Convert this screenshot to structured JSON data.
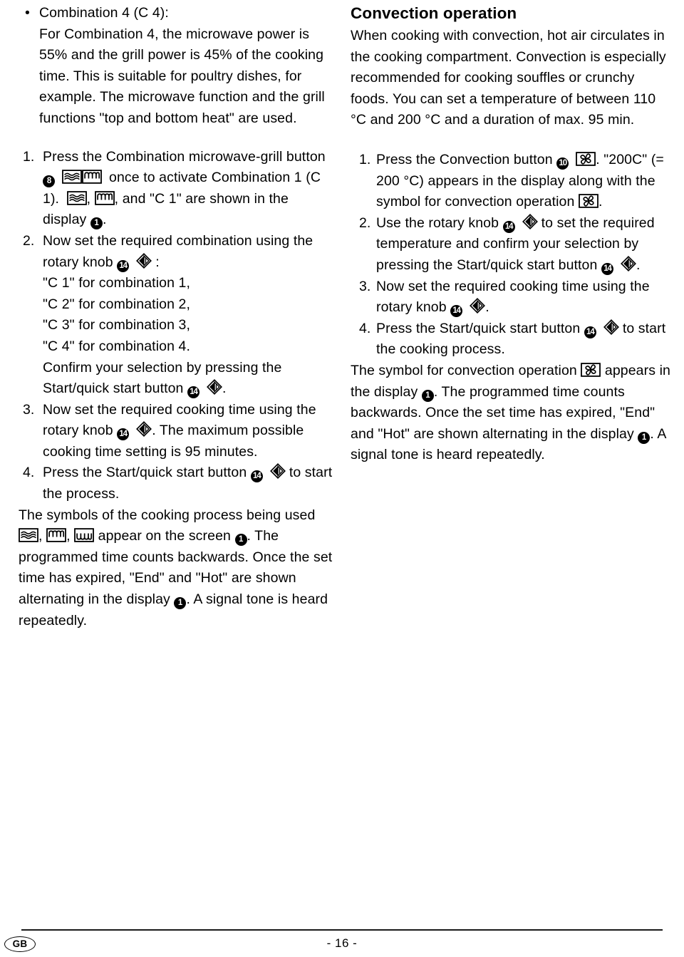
{
  "page": {
    "footer": {
      "language_badge": "GB",
      "page_number": "- 16 -"
    }
  },
  "left_column": {
    "bullet": {
      "marker": "•",
      "title": "Combination 4 (C 4):",
      "body": "For Combination 4, the microwave power is 55% and the grill power is 45% of the cooking time. This is suitable for poultry dishes, for example. The microwave function and the grill functions \"top and bottom heat\" are used."
    },
    "steps": {
      "s1_num": "1.",
      "s1_a": "Press the Combination microwave-grill button",
      "s1_badge": "8",
      "s1_b": "once to activate Combination 1 (C 1).",
      "s1_c": ",",
      "s1_d": ", and \"C 1\" are shown in the display",
      "s1_badge2": "1",
      "s1_e": ".",
      "s2_num": "2.",
      "s2_a": "Now set the required combination using the rotary knob",
      "s2_badge": "14",
      "s2_b": ":",
      "s2_list": [
        "\"C 1\" for combination 1,",
        "\"C 2\" for combination 2,",
        "\"C 3\" for combination 3,",
        "\"C 4\" for combination 4."
      ],
      "s2_confirm_a": "Confirm your selection by pressing the Start/quick start button",
      "s2_confirm_badge": "14",
      "s2_confirm_b": ".",
      "s3_num": "3.",
      "s3_a": "Now set the required cooking time using the rotary knob",
      "s3_badge": "14",
      "s3_b": ". The maximum possible cooking time setting is 95 minutes.",
      "s4_num": "4.",
      "s4_a": "Press the Start/quick start button",
      "s4_badge": "14",
      "s4_b": "to start the process."
    },
    "closing": {
      "a": "The symbols of the cooking process being used",
      "b": ",",
      "c": ",",
      "d": "appear on the screen",
      "badge": "1",
      "e": ". The programmed time counts backwards. Once the set time has expired, \"End\" and \"Hot\" are shown alternating in the display",
      "badge2": "1",
      "f": ". A signal tone is heard repeatedly."
    }
  },
  "right_column": {
    "heading": "Convection operation",
    "intro": "When cooking with convection, hot air circulates in the cooking compartment. Convection is especially recommended for cooking souffles or crunchy foods. You can set a temperature of between 110 °C and 200 °C and a duration of max. 95 min.",
    "steps": {
      "s1_num": "1.",
      "s1_a": "Press the Convection button",
      "s1_badge": "10",
      "s1_b": ". \"200C\" (= 200 °C) appears in the display along with the symbol for convection operation",
      "s1_c": ".",
      "s2_num": "2.",
      "s2_a": "Use the rotary knob",
      "s2_badge": "14",
      "s2_b": "to set the required temperature and confirm your selection by pressing the Start/quick start button",
      "s2_badge2": "14",
      "s2_c": ".",
      "s3_num": "3.",
      "s3_a": "Now set the required cooking time using the rotary knob",
      "s3_badge": "14",
      "s3_b": ".",
      "s4_num": "4.",
      "s4_a": "Press the Start/quick start button",
      "s4_badge": "14",
      "s4_b": "to start the cooking process."
    },
    "closing": {
      "a": "The symbol for convection operation",
      "b": "appears in the display",
      "badge": "1",
      "c": ". The programmed time counts backwards. Once the set time has expired, \"End\" and \"Hot\" are shown alternating in the display",
      "badge2": "1",
      "d": ". A signal tone is heard repeatedly."
    }
  },
  "icons": {
    "microwave": "microwave-waves-icon",
    "grill_top": "grill-top-heat-icon",
    "grill_bottom": "grill-bottom-heat-icon",
    "convection": "convection-fan-icon",
    "rotary": "rotary-knob-icon"
  },
  "colors": {
    "text": "#000000",
    "background": "#ffffff"
  }
}
